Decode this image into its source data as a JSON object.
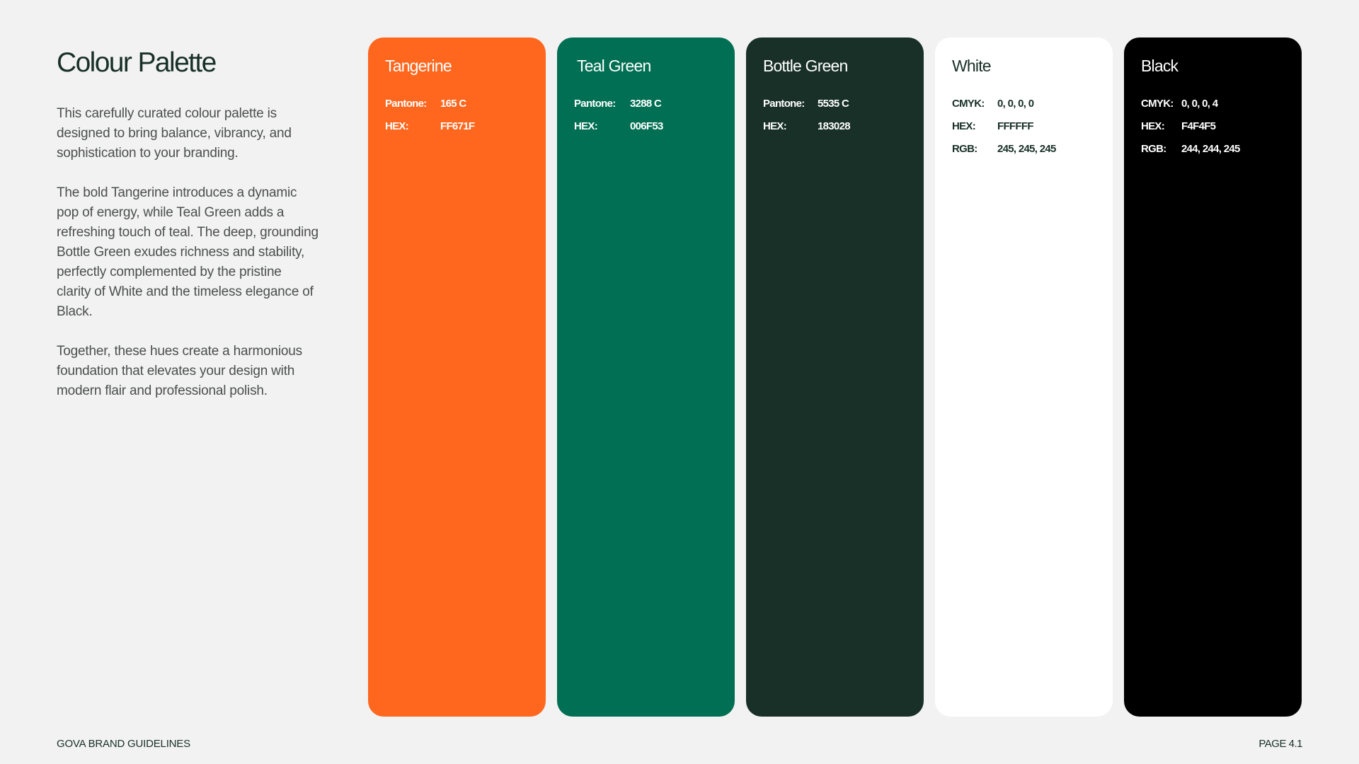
{
  "title": "Colour Palette",
  "paragraphs": [
    "This carefully curated colour palette is designed to bring balance, vibrancy, and sophistication to your branding.",
    "The bold Tangerine introduces a dynamic pop of energy, while Teal Green adds a refreshing touch of teal. The deep, grounding Bottle Green exudes richness and stability, perfectly complemented by the pristine clarity of White and the timeless elegance of Black.",
    "Together, these hues create a harmonious foundation that elevates your design with modern flair and professional polish."
  ],
  "swatches": [
    {
      "name": "Tangerine",
      "color": "#FF671F",
      "text_color": "#ffffff",
      "specs": [
        {
          "label": "Pantone:",
          "value": "165 C"
        },
        {
          "label": "HEX:",
          "value": "FF671F"
        }
      ]
    },
    {
      "name": "Teal Green",
      "color": "#006F53",
      "text_color": "#ffffff",
      "specs": [
        {
          "label": "Pantone:",
          "value": "3288 C"
        },
        {
          "label": "HEX:",
          "value": "006F53"
        }
      ]
    },
    {
      "name": "Bottle Green",
      "color": "#183028",
      "text_color": "#ffffff",
      "specs": [
        {
          "label": "Pantone:",
          "value": "5535 C"
        },
        {
          "label": "HEX:",
          "value": "183028"
        }
      ]
    },
    {
      "name": "White",
      "color": "#FFFFFF",
      "text_color": "#183028",
      "specs": [
        {
          "label": "CMYK:",
          "value": "0, 0, 0, 0"
        },
        {
          "label": "HEX:",
          "value": "FFFFFF"
        },
        {
          "label": "RGB:",
          "value": "245, 245, 245"
        }
      ]
    },
    {
      "name": "Black",
      "color": "#000000",
      "text_color": "#ffffff",
      "specs": [
        {
          "label": "CMYK:",
          "value": "0, 0, 0, 4"
        },
        {
          "label": "HEX:",
          "value": "F4F4F5"
        },
        {
          "label": "RGB:",
          "value": "244, 244, 245"
        }
      ]
    }
  ],
  "footer": {
    "left": "GOVA BRAND GUIDELINES",
    "right": "PAGE 4.1"
  }
}
